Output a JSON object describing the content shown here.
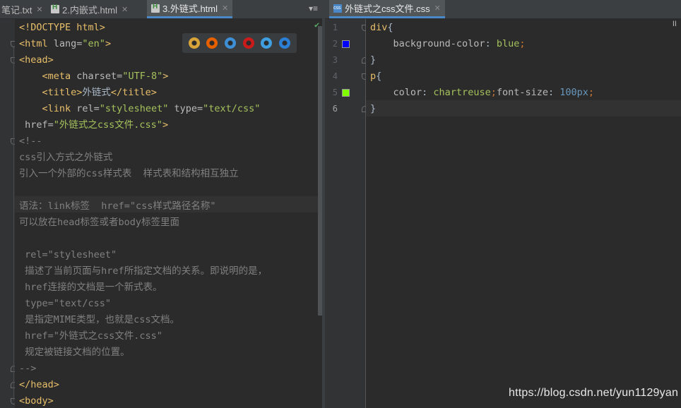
{
  "left_tabs": [
    {
      "label": "笔记.txt",
      "icon": "text-file-icon",
      "active": false
    },
    {
      "label": "2.内嵌式.html",
      "icon": "html5-file-icon",
      "active": false
    },
    {
      "label": "3.外链式.html",
      "icon": "html5-file-icon",
      "active": true
    }
  ],
  "right_tabs": [
    {
      "label": "外链式之css文件.css",
      "icon": "css-file-icon",
      "active": true
    }
  ],
  "tab_close_glyph": "✕",
  "tab_menu_glyph": "▾≡",
  "pause_glyph": "II",
  "left_editor": {
    "lines": [
      [
        {
          "t": "<!DOCTYPE html>",
          "c": "tag"
        }
      ],
      [
        {
          "t": "<html ",
          "c": "tag"
        },
        {
          "t": "lang=",
          "c": "attr"
        },
        {
          "t": "\"en\"",
          "c": "val"
        },
        {
          "t": ">",
          "c": "tag"
        }
      ],
      [
        {
          "t": "<head>",
          "c": "tag"
        }
      ],
      [
        {
          "t": "    <meta ",
          "c": "tag"
        },
        {
          "t": "charset=",
          "c": "attr"
        },
        {
          "t": "\"UTF-8\"",
          "c": "val"
        },
        {
          "t": ">",
          "c": "tag"
        }
      ],
      [
        {
          "t": "    <title>",
          "c": "tag"
        },
        {
          "t": "外链式",
          "c": "txt"
        },
        {
          "t": "</title>",
          "c": "tag"
        }
      ],
      [
        {
          "t": "    <link ",
          "c": "tag"
        },
        {
          "t": "rel=",
          "c": "attr"
        },
        {
          "t": "\"stylesheet\"",
          "c": "val"
        },
        {
          "t": " type=",
          "c": "attr"
        },
        {
          "t": "\"text/css\"",
          "c": "val"
        }
      ],
      [
        {
          "t": " href=",
          "c": "attr"
        },
        {
          "t": "\"外链式之css文件.css\"",
          "c": "val"
        },
        {
          "t": ">",
          "c": "tag"
        }
      ],
      [
        {
          "t": "<!--",
          "c": "cmt"
        }
      ],
      [
        {
          "t": "css引入方式之外链式",
          "c": "cmt"
        }
      ],
      [
        {
          "t": "引入一个外部的css样式表  样式表和结构相互独立",
          "c": "cmt"
        }
      ],
      [
        {
          "t": "",
          "c": "cmt"
        }
      ],
      [
        {
          "t": "语法：link标签  href=\"css样式路径名称\"",
          "c": "cmt"
        }
      ],
      [
        {
          "t": "可以放在head标签或者body标签里面",
          "c": "cmt"
        }
      ],
      [
        {
          "t": "",
          "c": "cmt"
        }
      ],
      [
        {
          "t": " rel=\"stylesheet\"",
          "c": "cmt"
        }
      ],
      [
        {
          "t": " 描述了当前页面与href所指定文档的关系。即说明的是，",
          "c": "cmt"
        }
      ],
      [
        {
          "t": " href连接的文档是一个新式表。",
          "c": "cmt"
        }
      ],
      [
        {
          "t": " type=\"text/css\"",
          "c": "cmt"
        }
      ],
      [
        {
          "t": " 是指定MIME类型，也就是css文档。",
          "c": "cmt"
        }
      ],
      [
        {
          "t": " href=\"外链式之css文件.css\"",
          "c": "cmt"
        }
      ],
      [
        {
          "t": " 规定被链接文档的位置。",
          "c": "cmt"
        }
      ],
      [
        {
          "t": "-->",
          "c": "cmt"
        }
      ],
      [
        {
          "t": "</head>",
          "c": "tag"
        }
      ],
      [
        {
          "t": "<body>",
          "c": "tag"
        }
      ]
    ]
  },
  "browser_icons": [
    "chrome-icon",
    "firefox-icon",
    "safari-icon",
    "opera-icon",
    "ie-icon",
    "edge-icon"
  ],
  "browser_colors": [
    "#d9a43a",
    "#e66000",
    "#3d8fd6",
    "#cc1b1b",
    "#3f9fe0",
    "#2b7fd4"
  ],
  "right_editor": {
    "line_numbers": [
      "1",
      "2",
      "3",
      "4",
      "5",
      "6"
    ],
    "lines": [
      [
        {
          "t": "div",
          "c": "selector"
        },
        {
          "t": "{",
          "c": "txt"
        }
      ],
      [
        {
          "t": "    background-color",
          "c": "prop"
        },
        {
          "t": ": ",
          "c": "txt"
        },
        {
          "t": "blue",
          "c": "pval"
        },
        {
          "t": ";",
          "c": "punc"
        }
      ],
      [
        {
          "t": "}",
          "c": "txt"
        }
      ],
      [
        {
          "t": "p",
          "c": "selector"
        },
        {
          "t": "{",
          "c": "txt"
        }
      ],
      [
        {
          "t": "    color",
          "c": "prop"
        },
        {
          "t": ": ",
          "c": "txt"
        },
        {
          "t": "chartreuse",
          "c": "pval"
        },
        {
          "t": ";",
          "c": "punc"
        },
        {
          "t": "font-size",
          "c": "prop"
        },
        {
          "t": ": ",
          "c": "txt"
        },
        {
          "t": "100px",
          "c": "num"
        },
        {
          "t": ";",
          "c": "punc"
        }
      ],
      [
        {
          "t": "}",
          "c": "txt"
        }
      ]
    ],
    "swatches": [
      {
        "line": 2,
        "color": "#0000ff"
      },
      {
        "line": 5,
        "color": "#7fff00"
      }
    ]
  },
  "watermark": "https://blog.csdn.net/yun1129yan"
}
